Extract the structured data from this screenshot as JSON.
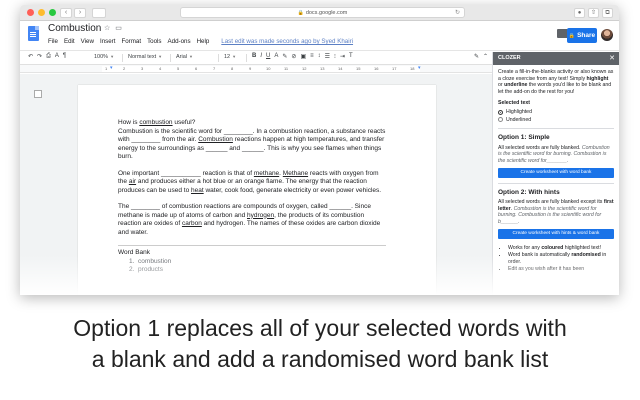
{
  "browser": {
    "url": "docs.google.com",
    "colors": {
      "close": "#ff5f57",
      "minimize": "#febc2e",
      "zoom": "#28c840"
    }
  },
  "doc": {
    "title": "Combustion",
    "menu": [
      "File",
      "Edit",
      "View",
      "Insert",
      "Format",
      "Tools",
      "Add-ons",
      "Help"
    ],
    "last_edit": "Last edit was made seconds ago by Syed Khairi",
    "share_label": "Share"
  },
  "toolbar": {
    "zoom": "100%",
    "style": "Normal text",
    "font": "Arial",
    "size": "12"
  },
  "ruler": {
    "numbers": [
      "1",
      "2",
      "3",
      "4",
      "5",
      "6",
      "7",
      "8",
      "9",
      "10",
      "11",
      "12",
      "13",
      "14",
      "15",
      "16",
      "17",
      "18"
    ]
  },
  "content": {
    "p1": {
      "a": "How is ",
      "b": "combustion",
      "c": " useful?",
      "d": "Combustion is the scientific word for ________. In a combustion reaction, a substance reacts with ________ from the air. ",
      "e": "Combustion",
      "f": " reactions happen at high temperatures, and transfer energy to the surroundings as ______ and ______. This is why you see flames when things burn."
    },
    "p2": {
      "a": "One important ___________ reaction is that of ",
      "b": "methane",
      "c": ". ",
      "d": "Methane",
      "e": " reacts with oxygen from the ",
      "f": "air",
      "g": " and produces either a hot blue or an orange flame. The energy that the reaction produces can be used to ",
      "h": "heat",
      "i": " water, cook food, generate electricity or even power vehicles."
    },
    "p3": {
      "a": "The ________ of combustion reactions are compounds of oxygen, called ______. Since methane is made up of atoms of carbon and ",
      "b": "hydrogen",
      "c": ", the products of its combustion reaction are oxides of ",
      "d": "carbon",
      "e": " and hydrogen. The names of these oxides are carbon dioxide and water."
    },
    "word_bank_title": "Word Bank",
    "word_bank": [
      "combustion",
      "products"
    ]
  },
  "panel": {
    "title": "CLOZER",
    "intro_a": "Create a fill-in-the-blanks activity or also known as a cloze exercise from any text! Simply ",
    "intro_b": "highlight",
    "intro_c": " or ",
    "intro_d": "underline",
    "intro_e": " the words you'd like to be blank and let the add-on do the rest for you!",
    "selected_text_label": "Selected text",
    "options": [
      "Highlighted",
      "Underlined"
    ],
    "option1_title": "Option 1: Simple",
    "option1_desc": "All selected words are fully blanked. ",
    "option1_example": "Combustion is the scientific word for burning. Combustion is the scientific word for_______.",
    "option1_button": "Create worksheet with word bank",
    "option2_title": "Option 2: With hints",
    "option2_desc_a": "All selected words are fully blanked except its ",
    "option2_desc_b": "first letter",
    "option2_desc_c": ". ",
    "option2_example": "Combustion is the scientific word for burning. Combustion is the scientific word for b______.",
    "option2_button": "Create worksheet with hints & word bank",
    "bullet1_a": "Works for any ",
    "bullet1_b": "coloured",
    "bullet1_c": " highlighted text!",
    "bullet2_a": "Word bank is automatically ",
    "bullet2_b": "randomised",
    "bullet2_c": " in order.",
    "bullet3": "Edit as you wish after it has been"
  },
  "caption": {
    "line1": "Option 1 replaces all of your selected words with",
    "line2": "a blank and add a randomised word bank list"
  }
}
